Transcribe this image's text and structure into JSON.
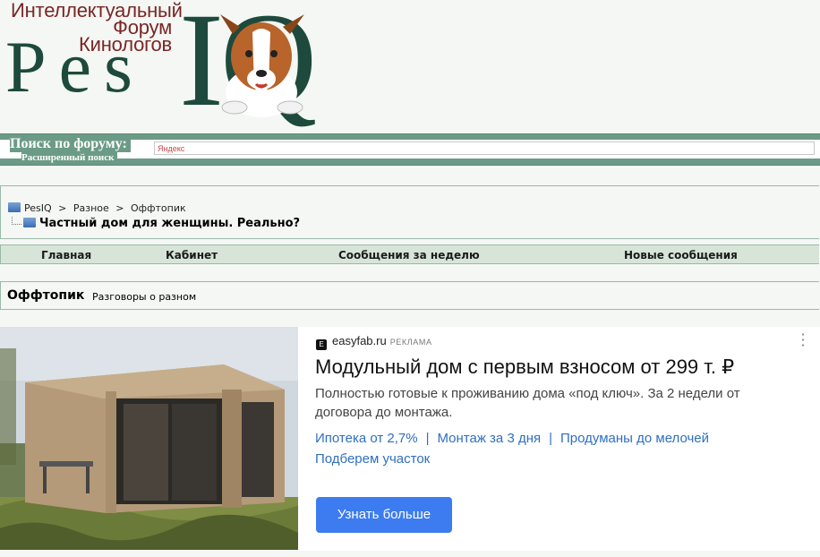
{
  "header": {
    "tagline_lines": [
      "Интеллектуальный",
      "Форум",
      "Кинологов"
    ],
    "logo_text_left": "Pes",
    "logo_text_right": "IQ"
  },
  "search": {
    "title": "Поиск по форуму:",
    "advanced_label": "Расширенный поиск",
    "input_placeholder": "Яндекс"
  },
  "breadcrumb": {
    "items": [
      "PesIQ",
      "Разное",
      "Оффтопик"
    ],
    "separator": ">",
    "current": "Частный дом для женщины. Реально?"
  },
  "nav": {
    "items": [
      "Главная",
      "Кабинет",
      "Сообщения за неделю",
      "Новые сообщения"
    ]
  },
  "section": {
    "title": "Оффтопик",
    "subtitle": "Разговоры о разном"
  },
  "ad": {
    "domain": "easyfab.ru",
    "tag": "РЕКЛАМА",
    "title": "Модульный дом с первым взносом от 299 т. ₽",
    "description": "Полностью готовые к проживанию дома «под ключ». За 2 недели от договора до монтажа.",
    "links": [
      "Ипотека от 2,7%",
      "Монтаж за 3 дня",
      "Продуманы до мелочей",
      "Подберем участок"
    ],
    "link_separator": "|",
    "button_label": "Узнать больше"
  },
  "colors": {
    "brand_green": "#1d4a3c",
    "tagline_red": "#7a2626",
    "search_bar": "#6b9b86",
    "nav_bg": "#d7e5d9",
    "ad_link": "#2f6fc0",
    "ad_button": "#3c7cf0"
  }
}
